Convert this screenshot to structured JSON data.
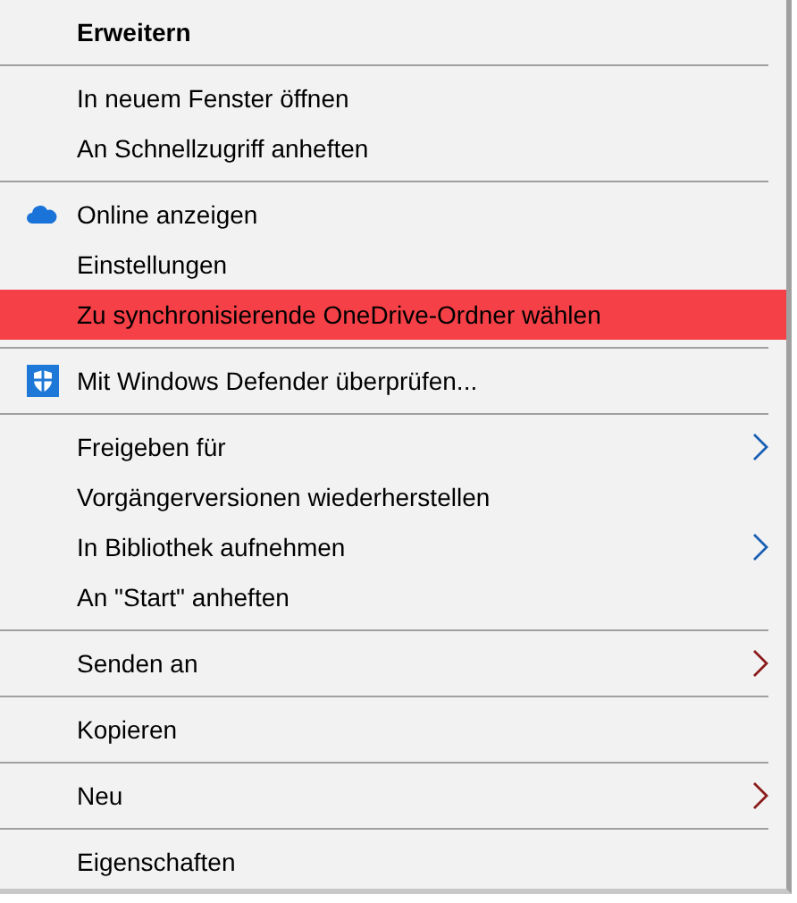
{
  "menu": {
    "groups": [
      {
        "items": [
          {
            "label": "Erweitern",
            "bold": true,
            "selected": false
          }
        ]
      },
      {
        "items": [
          {
            "label": "In neuem Fenster öffnen",
            "selected": false
          },
          {
            "label": "An Schnellzugriff anheften",
            "selected": false
          }
        ]
      },
      {
        "items": [
          {
            "label": "Online anzeigen",
            "kind": "cloud",
            "selected": false
          },
          {
            "label": "Einstellungen",
            "selected": false
          },
          {
            "label": "Zu synchronisierende OneDrive-Ordner wählen",
            "selected": true
          }
        ]
      },
      {
        "items": [
          {
            "label": "Mit Windows Defender überprüfen...",
            "kind": "shield",
            "selected": false
          }
        ]
      },
      {
        "items": [
          {
            "label": "Freigeben für",
            "submenu": true,
            "color": "#1a5fb4",
            "selected": false
          },
          {
            "label": "Vorgängerversionen wiederherstellen",
            "selected": false
          },
          {
            "label": "In Bibliothek aufnehmen",
            "submenu": true,
            "color": "#1a5fb4",
            "selected": false
          },
          {
            "label": "An \"Start\" anheften",
            "selected": false
          }
        ]
      },
      {
        "items": [
          {
            "label": "Senden an",
            "submenu": true,
            "color": "#8b1a1a",
            "selected": false
          }
        ]
      },
      {
        "items": [
          {
            "label": "Kopieren",
            "selected": false
          }
        ]
      },
      {
        "items": [
          {
            "label": "Neu",
            "submenu": true,
            "color": "#8b1a1a",
            "selected": false
          }
        ]
      },
      {
        "items": [
          {
            "label": "Eigenschaften",
            "selected": false
          }
        ]
      }
    ]
  }
}
